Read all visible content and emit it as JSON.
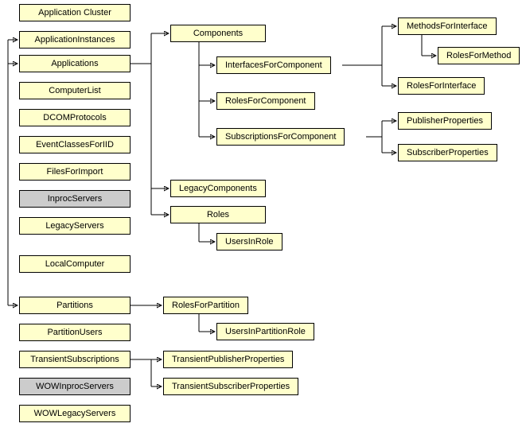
{
  "nodes": {
    "applicationCluster": "Application Cluster",
    "applicationInstances": "ApplicationInstances",
    "applications": "Applications",
    "computerList": "ComputerList",
    "dcomProtocols": "DCOMProtocols",
    "eventClassesForIID": "EventClassesForIID",
    "filesForImport": "FilesForImport",
    "inprocServers": "InprocServers",
    "legacyServers": "LegacyServers",
    "localComputer": "LocalComputer",
    "partitions": "Partitions",
    "partitionUsers": "PartitionUsers",
    "transientSubscriptions": "TransientSubscriptions",
    "wowInprocServers": "WOWInprocServers",
    "wowLegacyServers": "WOWLegacyServers",
    "components": "Components",
    "legacyComponents": "LegacyComponents",
    "roles": "Roles",
    "usersInRole": "UsersInRole",
    "interfacesForComponent": "InterfacesForComponent",
    "rolesForComponent": "RolesForComponent",
    "subscriptionsForComponent": "SubscriptionsForComponent",
    "methodsForInterface": "MethodsForInterface",
    "rolesForMethod": "RolesForMethod",
    "rolesForInterface": "RolesForInterface",
    "publisherProperties": "PublisherProperties",
    "subscriberProperties": "SubscriberProperties",
    "rolesForPartition": "RolesForPartition",
    "usersInPartitionRole": "UsersInPartitionRole",
    "transientPublisherProperties": "TransientPublisherProperties",
    "transientSubscriberProperties": "TransientSubscriberProperties"
  }
}
